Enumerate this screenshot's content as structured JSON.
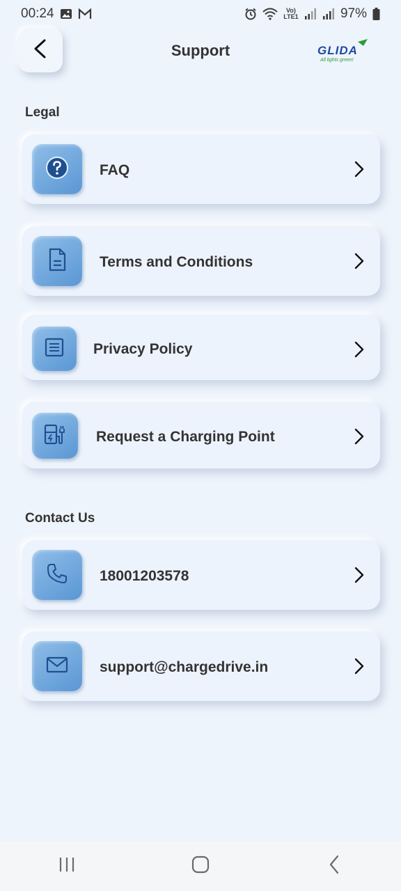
{
  "status_bar": {
    "time": "00:24",
    "battery": "97%",
    "network_label": "Vo) LTE1"
  },
  "header": {
    "title": "Support",
    "logo_text": "GLIDA",
    "logo_tagline": "All lights green!"
  },
  "sections": {
    "legal": "Legal",
    "contact": "Contact Us"
  },
  "legal_items": [
    {
      "label": "FAQ",
      "icon": "question-icon"
    },
    {
      "label": "Terms and Conditions",
      "icon": "document-icon"
    },
    {
      "label": "Privacy Policy",
      "icon": "list-document-icon"
    },
    {
      "label": "Request a Charging Point",
      "icon": "charging-station-icon"
    }
  ],
  "contact_items": [
    {
      "label": "18001203578",
      "icon": "phone-icon"
    },
    {
      "label": "support@chargedrive.in",
      "icon": "mail-icon"
    }
  ],
  "colors": {
    "background": "#eef4fc",
    "icon_tile": "#6aa3da",
    "icon_stroke": "#1f4f8f"
  }
}
